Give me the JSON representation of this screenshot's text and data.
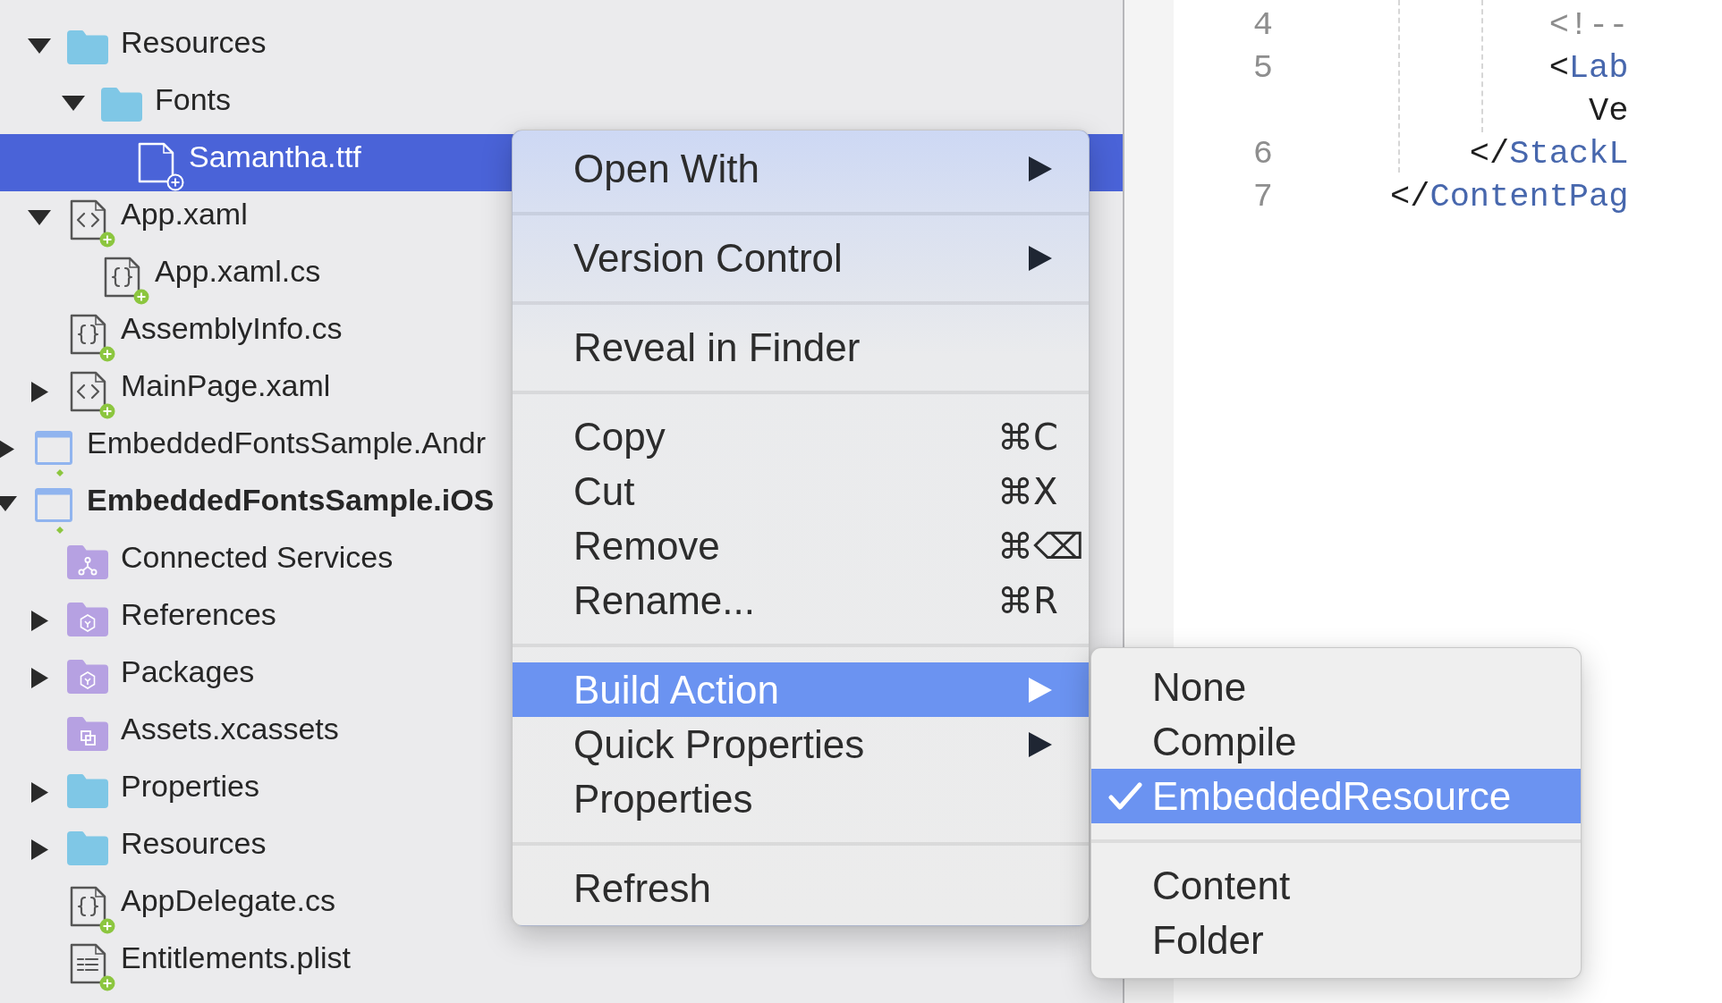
{
  "explorer": {
    "tree": [
      {
        "children": [
          {
            "label": "Resources",
            "kind": "folder",
            "expanded": true,
            "selected": false,
            "children": [
              {
                "label": "Fonts",
                "kind": "folder",
                "expanded": true,
                "selected": false,
                "children": [
                  {
                    "label": "Samantha.ttf",
                    "kind": "font",
                    "selected": true
                  }
                ]
              }
            ]
          },
          {
            "label": "App.xaml",
            "kind": "markup",
            "expanded": true,
            "selected": false,
            "children": [
              {
                "label": "App.xaml.cs",
                "kind": "code",
                "selected": false
              }
            ]
          },
          {
            "label": "AssemblyInfo.cs",
            "kind": "code",
            "selected": false
          },
          {
            "label": "MainPage.xaml",
            "kind": "markup",
            "expanded": false,
            "selected": false
          }
        ]
      },
      {
        "label": "EmbeddedFontsSample.Andr",
        "kind": "project",
        "expanded": false,
        "selected": false,
        "startup": false
      },
      {
        "label": "EmbeddedFontsSample.iOS",
        "kind": "project",
        "expanded": true,
        "selected": false,
        "startup": true,
        "children": [
          {
            "label": "Connected Services",
            "kind": "services",
            "selected": false
          },
          {
            "label": "References",
            "kind": "library",
            "expanded": false,
            "selected": false
          },
          {
            "label": "Packages",
            "kind": "library",
            "expanded": false,
            "selected": false
          },
          {
            "label": "Assets.xcassets",
            "kind": "assets",
            "selected": false
          },
          {
            "label": "Properties",
            "kind": "folder",
            "expanded": false,
            "selected": false
          },
          {
            "label": "Resources",
            "kind": "folder",
            "expanded": false,
            "selected": false
          },
          {
            "label": "AppDelegate.cs",
            "kind": "code",
            "selected": false
          },
          {
            "label": "Entitlements.plist",
            "kind": "plist",
            "selected": false
          }
        ]
      }
    ]
  },
  "context_menu": {
    "groups": [
      {
        "items": [
          {
            "label": "Open With",
            "has_submenu": true,
            "selected": false
          }
        ]
      },
      {
        "items": [
          {
            "label": "Version Control",
            "has_submenu": true,
            "selected": false
          }
        ]
      },
      {
        "items": [
          {
            "label": "Reveal in Finder",
            "has_submenu": false,
            "selected": false
          }
        ]
      },
      {
        "items": [
          {
            "label": "Copy",
            "shortcut": "⌘C",
            "has_submenu": false,
            "selected": false
          },
          {
            "label": "Cut",
            "shortcut": "⌘X",
            "has_submenu": false,
            "selected": false
          },
          {
            "label": "Remove",
            "shortcut": "⌘⌫",
            "has_submenu": false,
            "selected": false
          },
          {
            "label": "Rename...",
            "shortcut": "⌘R",
            "has_submenu": false,
            "selected": false
          }
        ]
      },
      {
        "items": [
          {
            "label": "Build Action",
            "has_submenu": true,
            "selected": true
          },
          {
            "label": "Quick Properties",
            "has_submenu": true,
            "selected": false
          },
          {
            "label": "Properties",
            "has_submenu": false,
            "selected": false
          }
        ]
      },
      {
        "items": [
          {
            "label": "Refresh",
            "has_submenu": false,
            "selected": false
          }
        ]
      }
    ]
  },
  "build_action_submenu": {
    "groups": [
      {
        "items": [
          {
            "label": "None",
            "checked": false,
            "selected": false
          },
          {
            "label": "Compile",
            "checked": false,
            "selected": false
          },
          {
            "label": "EmbeddedResource",
            "checked": true,
            "selected": true
          }
        ]
      },
      {
        "items": [
          {
            "label": "Content",
            "checked": false,
            "selected": false
          },
          {
            "label": "Folder",
            "checked": false,
            "selected": false
          }
        ]
      }
    ]
  },
  "editor": {
    "lines": [
      {
        "number": "4",
        "tokens": [
          {
            "kind": "comment",
            "text": "        <!--"
          }
        ]
      },
      {
        "number": "5",
        "tokens": [
          {
            "kind": "punct",
            "text": "        <"
          },
          {
            "kind": "tag",
            "text": "Lab"
          }
        ]
      },
      {
        "tokens": [
          {
            "kind": "text",
            "text": "          Ve"
          }
        ]
      },
      {
        "number": "6",
        "tokens": [
          {
            "kind": "punct",
            "text": "    </"
          },
          {
            "kind": "tag",
            "text": "StackL"
          }
        ]
      },
      {
        "number": "7",
        "tokens": [
          {
            "kind": "punct",
            "text": "</"
          },
          {
            "kind": "tag",
            "text": "ContentPag"
          }
        ]
      }
    ]
  }
}
